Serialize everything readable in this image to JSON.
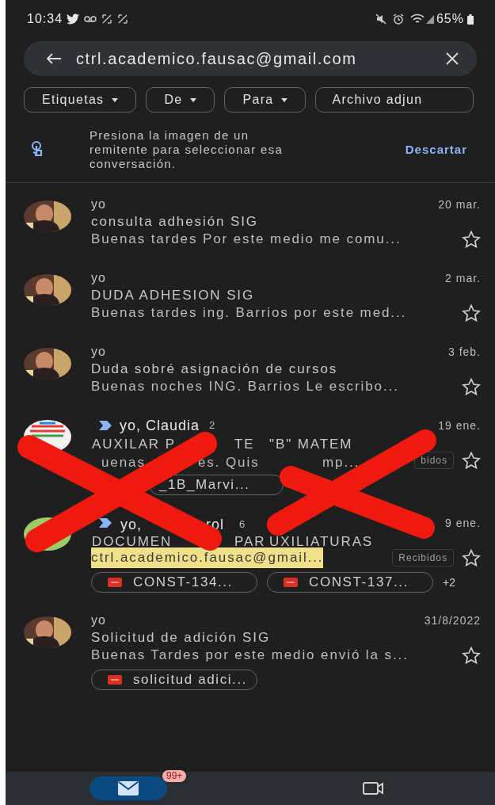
{
  "status_bar": {
    "time": "10:34",
    "battery": "65%"
  },
  "search": {
    "query": "ctrl.academico.fausac@gmail.com"
  },
  "filters": [
    {
      "label": "Etiquetas",
      "dropdown": true
    },
    {
      "label": "De",
      "dropdown": true
    },
    {
      "label": "Para",
      "dropdown": true
    },
    {
      "label": "Archivo adjun",
      "dropdown": false
    }
  ],
  "hint": {
    "text": "Presiona la imagen de un remitente para seleccionar esa conversación.",
    "action": "Descartar"
  },
  "threads": [
    {
      "important": false,
      "sender_parts": [
        "yo"
      ],
      "date": "20 mar.",
      "subject_parts": [
        "consulta adhesión SIG"
      ],
      "snippet_parts": [
        "Buenas tardes Por este medio me comu..."
      ],
      "highlighted": false,
      "starred": false
    },
    {
      "important": false,
      "sender_parts": [
        "yo"
      ],
      "date": "2 mar.",
      "subject_parts": [
        "DUDA ADHESION SIG"
      ],
      "snippet_parts": [
        "Buenas tardes ing. Barrios por este med..."
      ],
      "highlighted": false,
      "starred": false
    },
    {
      "important": false,
      "sender_parts": [
        "yo"
      ],
      "date": "3 feb.",
      "subject_parts": [
        "Duda sobré asignación de cursos"
      ],
      "snippet_parts": [
        "Buenas noches ING. Barrios Le escribo..."
      ],
      "highlighted": false,
      "starred": false
    },
    {
      "important": true,
      "sender_parts": [
        "yo, Claudia"
      ],
      "count": "2",
      "date": "19 ene.",
      "subject_parts": [
        "AUXILAR P",
        "TE",
        "\"B\" MATEM"
      ],
      "snippet_parts": [
        "uenas",
        "es. Quis",
        "mp..."
      ],
      "label": "bidos",
      "highlighted": false,
      "starred": false,
      "attachments": [
        {
          "name": "_1B_Marvi...",
          "icon": false
        }
      ]
    },
    {
      "important": true,
      "sender_parts": [
        "yo,",
        "rol"
      ],
      "count": "6",
      "date": "9 ene.",
      "subject_parts": [
        "DOCUMEN",
        "PAR",
        "UXILIATURAS"
      ],
      "snippet_parts": [
        "ctrl.academico.fausac@gmail..."
      ],
      "label": "Recibidos",
      "highlighted": true,
      "starred": false,
      "attachments": [
        {
          "name": "CONST-134...",
          "icon": true
        },
        {
          "name": "CONST-137...",
          "icon": true
        }
      ],
      "more": "+2"
    },
    {
      "important": false,
      "sender_parts": [
        "yo"
      ],
      "date": "31/8/2022",
      "subject_parts": [
        "Solicitud de adición  SIG"
      ],
      "snippet_parts": [
        "Buenas Tardes por este medio envió la s..."
      ],
      "highlighted": false,
      "starred": false,
      "attachments": [
        {
          "name": "solicitud adici...",
          "icon": true
        }
      ]
    }
  ],
  "bottom_nav": [
    {
      "kind": "mail",
      "badge": "99+",
      "selected": true
    },
    {
      "kind": "meet",
      "selected": false
    }
  ]
}
